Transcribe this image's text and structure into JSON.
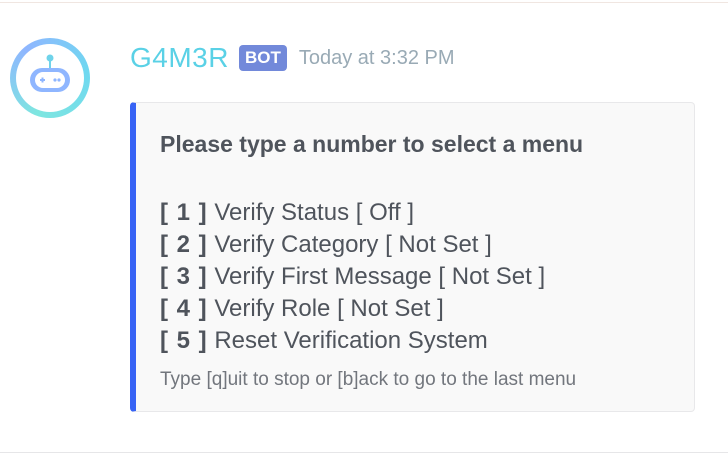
{
  "message": {
    "author": "G4M3R",
    "badge": "BOT",
    "timestamp": "Today at 3:32 PM",
    "avatar_icon": "robot-icon",
    "colors": {
      "author": "#5ad1e6",
      "badge": "#7289da",
      "embed_accent": "#3763f5"
    }
  },
  "embed": {
    "title": "Please type a number to select a menu",
    "items": [
      {
        "num": "[ 1 ]",
        "label": "Verify Status [ Off ]"
      },
      {
        "num": "[ 2 ]",
        "label": "Verify Category [ Not Set ]"
      },
      {
        "num": "[ 3 ]",
        "label": "Verify First Message [ Not Set ]"
      },
      {
        "num": "[ 4 ]",
        "label": "Verify Role [ Not Set ]"
      },
      {
        "num": "[ 5 ]",
        "label": "Reset Verification System"
      }
    ],
    "footer": "Type [q]uit to stop or [b]ack to go to the last menu"
  }
}
